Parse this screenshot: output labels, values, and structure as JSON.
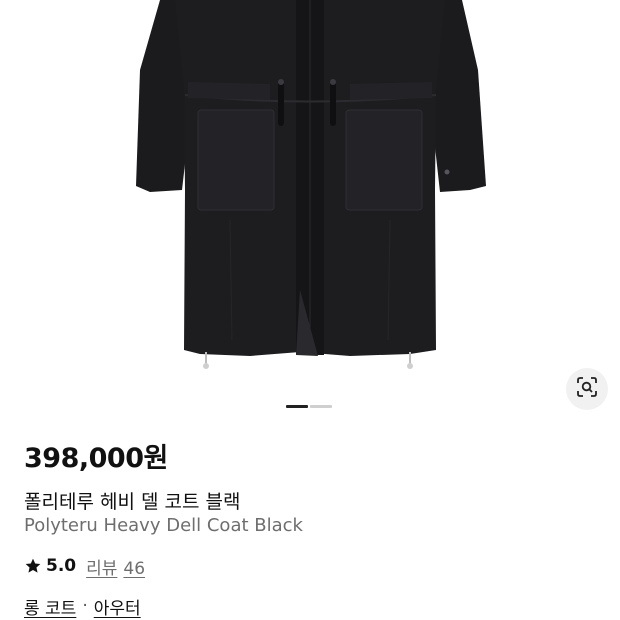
{
  "product": {
    "image_alt": "Polyteru Heavy Dell Coat Black",
    "price": "398,000원",
    "name_ko": "폴리테루 헤비 델 코트 블랙",
    "name_en": "Polyteru Heavy Dell Coat Black",
    "rating": "5.0",
    "review_label": "리뷰",
    "review_count": "46"
  },
  "carousel": {
    "total_slides": 2,
    "active_slide": 1
  },
  "icons": {
    "visual_search": "image-search-icon",
    "rating": "star-icon"
  },
  "categories": {
    "items": [
      "롱 코트",
      "아우터"
    ],
    "separator": "·"
  },
  "colors": {
    "coat": "#1a1a1c",
    "text_primary": "#111111",
    "text_secondary": "#6e6e6e",
    "dot_active": "#222222",
    "dot_inactive": "#cfcfcf"
  }
}
